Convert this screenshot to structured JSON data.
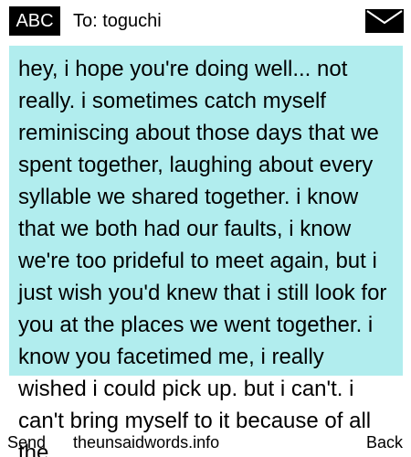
{
  "header": {
    "input_mode": "ABC",
    "recipient_label": "To: toguchi",
    "icon": "envelope-icon"
  },
  "message": {
    "body": "hey, i hope you're doing well... not really. i sometimes catch myself reminiscing about those days that we spent together, laughing about every syllable we shared together. i know that we both had our faults, i know we're too prideful to meet again, but i just wish you'd knew that i still look for you at the places we went together. i know you facetimed me, i really wished i could pick up. but i can't. i can't bring myself to it because of all the"
  },
  "footer": {
    "left_softkey": "Send",
    "center_text": "theunsaidwords.info",
    "right_softkey": "Back"
  },
  "colors": {
    "highlight": "#b1edee",
    "badge": "#000000"
  }
}
